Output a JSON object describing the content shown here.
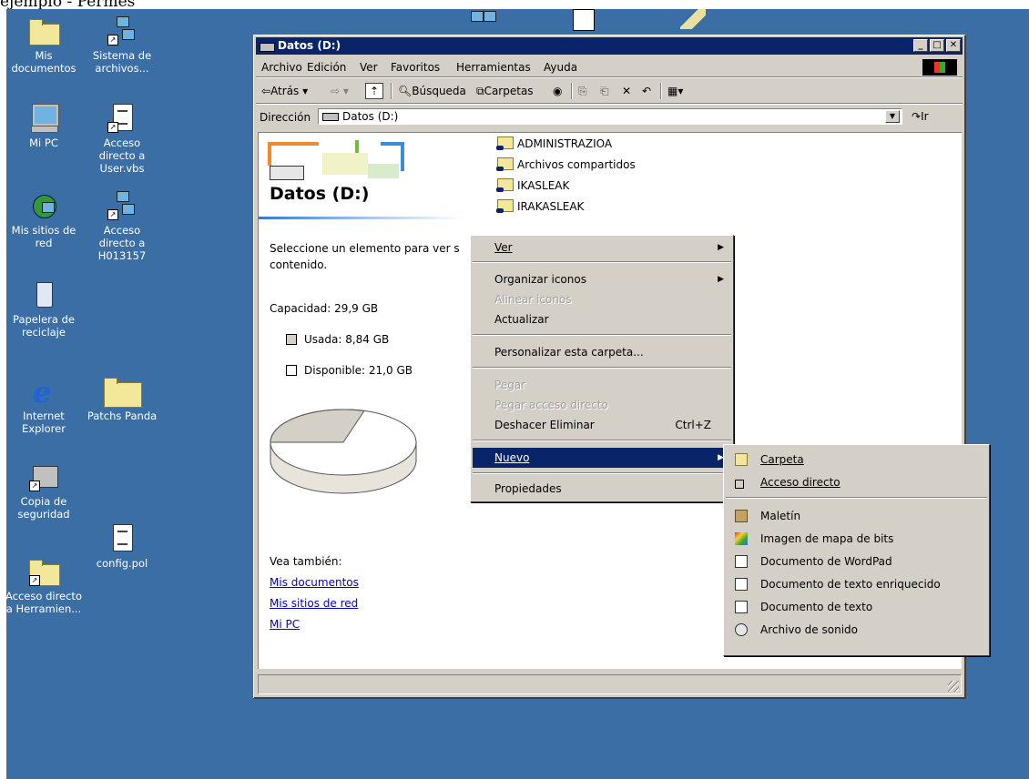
{
  "caption": "ejemplo - Permes",
  "desktop": {
    "icons": [
      {
        "label": "Mis documentos",
        "name": "desktop-icon-mis-documentos"
      },
      {
        "label": "Sistema de archivos...",
        "name": "desktop-icon-sistema-de-archivos"
      },
      {
        "label": "Mi PC",
        "name": "desktop-icon-mi-pc"
      },
      {
        "label": "Acceso directo a User.vbs",
        "name": "desktop-icon-acceso-user-vbs"
      },
      {
        "label": "Mis sitios de red",
        "name": "desktop-icon-mis-sitios-de-red"
      },
      {
        "label": "Acceso directo a H013157",
        "name": "desktop-icon-acceso-h013157"
      },
      {
        "label": "Papelera de reciclaje",
        "name": "desktop-icon-papelera"
      },
      {
        "label": "Internet Explorer",
        "name": "desktop-icon-internet-explorer"
      },
      {
        "label": "Patchs Panda",
        "name": "desktop-icon-patchs-panda"
      },
      {
        "label": "Copia de seguridad",
        "name": "desktop-icon-copia-de-seguridad"
      },
      {
        "label": "config.pol",
        "name": "desktop-icon-config-pol"
      },
      {
        "label": "Acceso directo a Herramien...",
        "name": "desktop-icon-acceso-herramientas"
      }
    ]
  },
  "window": {
    "title": "Datos (D:)",
    "menu": [
      "Archivo",
      "Edición",
      "Ver",
      "Favoritos",
      "Herramientas",
      "Ayuda"
    ],
    "toolbar": {
      "back": "Atrás",
      "search": "Búsqueda",
      "folders": "Carpetas"
    },
    "address": {
      "label": "Dirección",
      "value": "Datos (D:)",
      "go": "Ir"
    },
    "panel": {
      "heading": "Datos (D:)",
      "hint": "Seleccione un elemento para ver s contenido.",
      "capacity": "Capacidad: 29,9 GB",
      "used": "Usada: 8,84 GB",
      "free": "Disponible: 21,0 GB",
      "see_also": "Vea también:",
      "links": [
        "Mis documentos",
        "Mis sitios de red",
        "Mi PC"
      ]
    },
    "files": [
      "ADMINISTRAZIOA",
      "Archivos compartidos",
      "IKASLEAK",
      "IRAKASLEAK"
    ],
    "disk_usage": {
      "used_gb": 8.84,
      "free_gb": 21.0,
      "total_gb": 29.9
    }
  },
  "context_menu": {
    "items": [
      {
        "label": "Ver",
        "submenu": true,
        "disabled": false
      },
      {
        "label": "Organizar iconos",
        "submenu": true,
        "disabled": false
      },
      {
        "label": "Alinear iconos",
        "submenu": false,
        "disabled": true
      },
      {
        "label": "Actualizar",
        "submenu": false,
        "disabled": false
      },
      {
        "label": "Personalizar esta carpeta...",
        "submenu": false,
        "disabled": false
      },
      {
        "label": "Pegar",
        "submenu": false,
        "disabled": true
      },
      {
        "label": "Pegar acceso directo",
        "submenu": false,
        "disabled": true
      },
      {
        "label": "Deshacer Eliminar",
        "shortcut": "Ctrl+Z",
        "submenu": false,
        "disabled": false
      },
      {
        "label": "Nuevo",
        "submenu": true,
        "disabled": false,
        "selected": true
      },
      {
        "label": "Propiedades",
        "submenu": false,
        "disabled": false
      }
    ]
  },
  "submenu_nuevo": {
    "items": [
      "Carpeta",
      "Acceso directo",
      "Maletín",
      "Imagen de mapa de bits",
      "Documento de WordPad",
      "Documento de texto enriquecido",
      "Documento de texto",
      "Archivo de sonido"
    ]
  },
  "colors": {
    "desktop": "#3a6ea5",
    "titlebar": "#0a246a",
    "face": "#d4d0c8"
  }
}
